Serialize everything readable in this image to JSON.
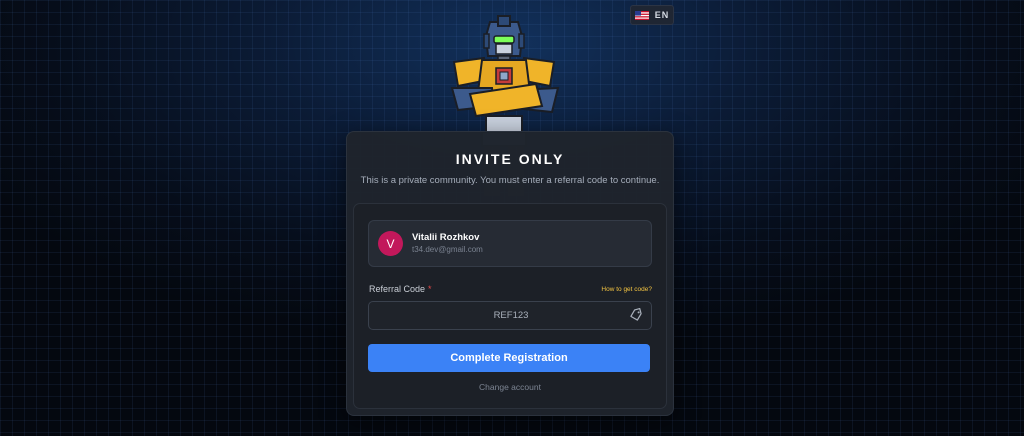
{
  "language": {
    "code": "EN",
    "flag_icon": "us-flag-icon"
  },
  "mascot": {
    "icon": "robot-mascot"
  },
  "card": {
    "title": "INVITE ONLY",
    "subtitle": "This is a private community. You must enter a referral code to continue."
  },
  "account": {
    "avatar_initial": "V",
    "avatar_color": "#c2185b",
    "name": "Vitalii Rozhkov",
    "email": "t34.dev@gmail.com"
  },
  "referral": {
    "label": "Referral Code",
    "required_marker": "*",
    "help_link": "How to get code?",
    "value": "REF123",
    "icon": "tag-icon"
  },
  "actions": {
    "submit_label": "Complete Registration",
    "change_account": "Change account"
  },
  "colors": {
    "accent": "#3b82f6",
    "link": "#f5c542",
    "required": "#e54848"
  }
}
